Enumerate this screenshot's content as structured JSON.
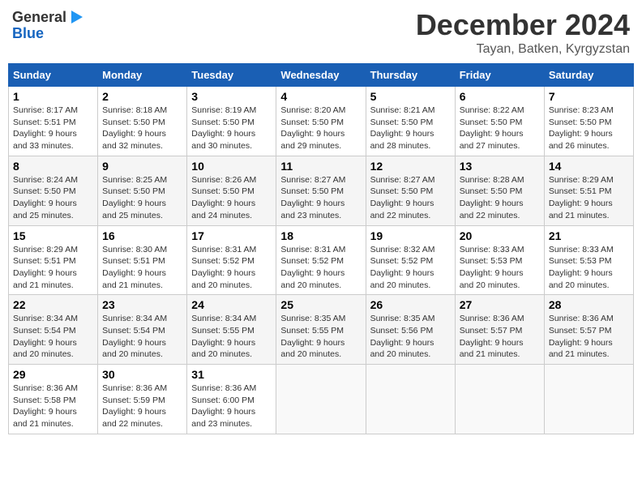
{
  "header": {
    "logo": {
      "general": "General",
      "blue": "Blue"
    },
    "month": "December 2024",
    "location": "Tayan, Batken, Kyrgyzstan"
  },
  "weekdays": [
    "Sunday",
    "Monday",
    "Tuesday",
    "Wednesday",
    "Thursday",
    "Friday",
    "Saturday"
  ],
  "weeks": [
    [
      {
        "day": "1",
        "sunrise": "8:17 AM",
        "sunset": "5:51 PM",
        "daylight": "9 hours and 33 minutes."
      },
      {
        "day": "2",
        "sunrise": "8:18 AM",
        "sunset": "5:50 PM",
        "daylight": "9 hours and 32 minutes."
      },
      {
        "day": "3",
        "sunrise": "8:19 AM",
        "sunset": "5:50 PM",
        "daylight": "9 hours and 30 minutes."
      },
      {
        "day": "4",
        "sunrise": "8:20 AM",
        "sunset": "5:50 PM",
        "daylight": "9 hours and 29 minutes."
      },
      {
        "day": "5",
        "sunrise": "8:21 AM",
        "sunset": "5:50 PM",
        "daylight": "9 hours and 28 minutes."
      },
      {
        "day": "6",
        "sunrise": "8:22 AM",
        "sunset": "5:50 PM",
        "daylight": "9 hours and 27 minutes."
      },
      {
        "day": "7",
        "sunrise": "8:23 AM",
        "sunset": "5:50 PM",
        "daylight": "9 hours and 26 minutes."
      }
    ],
    [
      {
        "day": "8",
        "sunrise": "8:24 AM",
        "sunset": "5:50 PM",
        "daylight": "9 hours and 25 minutes."
      },
      {
        "day": "9",
        "sunrise": "8:25 AM",
        "sunset": "5:50 PM",
        "daylight": "9 hours and 25 minutes."
      },
      {
        "day": "10",
        "sunrise": "8:26 AM",
        "sunset": "5:50 PM",
        "daylight": "9 hours and 24 minutes."
      },
      {
        "day": "11",
        "sunrise": "8:27 AM",
        "sunset": "5:50 PM",
        "daylight": "9 hours and 23 minutes."
      },
      {
        "day": "12",
        "sunrise": "8:27 AM",
        "sunset": "5:50 PM",
        "daylight": "9 hours and 22 minutes."
      },
      {
        "day": "13",
        "sunrise": "8:28 AM",
        "sunset": "5:50 PM",
        "daylight": "9 hours and 22 minutes."
      },
      {
        "day": "14",
        "sunrise": "8:29 AM",
        "sunset": "5:51 PM",
        "daylight": "9 hours and 21 minutes."
      }
    ],
    [
      {
        "day": "15",
        "sunrise": "8:29 AM",
        "sunset": "5:51 PM",
        "daylight": "9 hours and 21 minutes."
      },
      {
        "day": "16",
        "sunrise": "8:30 AM",
        "sunset": "5:51 PM",
        "daylight": "9 hours and 21 minutes."
      },
      {
        "day": "17",
        "sunrise": "8:31 AM",
        "sunset": "5:52 PM",
        "daylight": "9 hours and 20 minutes."
      },
      {
        "day": "18",
        "sunrise": "8:31 AM",
        "sunset": "5:52 PM",
        "daylight": "9 hours and 20 minutes."
      },
      {
        "day": "19",
        "sunrise": "8:32 AM",
        "sunset": "5:52 PM",
        "daylight": "9 hours and 20 minutes."
      },
      {
        "day": "20",
        "sunrise": "8:33 AM",
        "sunset": "5:53 PM",
        "daylight": "9 hours and 20 minutes."
      },
      {
        "day": "21",
        "sunrise": "8:33 AM",
        "sunset": "5:53 PM",
        "daylight": "9 hours and 20 minutes."
      }
    ],
    [
      {
        "day": "22",
        "sunrise": "8:34 AM",
        "sunset": "5:54 PM",
        "daylight": "9 hours and 20 minutes."
      },
      {
        "day": "23",
        "sunrise": "8:34 AM",
        "sunset": "5:54 PM",
        "daylight": "9 hours and 20 minutes."
      },
      {
        "day": "24",
        "sunrise": "8:34 AM",
        "sunset": "5:55 PM",
        "daylight": "9 hours and 20 minutes."
      },
      {
        "day": "25",
        "sunrise": "8:35 AM",
        "sunset": "5:55 PM",
        "daylight": "9 hours and 20 minutes."
      },
      {
        "day": "26",
        "sunrise": "8:35 AM",
        "sunset": "5:56 PM",
        "daylight": "9 hours and 20 minutes."
      },
      {
        "day": "27",
        "sunrise": "8:36 AM",
        "sunset": "5:57 PM",
        "daylight": "9 hours and 21 minutes."
      },
      {
        "day": "28",
        "sunrise": "8:36 AM",
        "sunset": "5:57 PM",
        "daylight": "9 hours and 21 minutes."
      }
    ],
    [
      {
        "day": "29",
        "sunrise": "8:36 AM",
        "sunset": "5:58 PM",
        "daylight": "9 hours and 21 minutes."
      },
      {
        "day": "30",
        "sunrise": "8:36 AM",
        "sunset": "5:59 PM",
        "daylight": "9 hours and 22 minutes."
      },
      {
        "day": "31",
        "sunrise": "8:36 AM",
        "sunset": "6:00 PM",
        "daylight": "9 hours and 23 minutes."
      },
      null,
      null,
      null,
      null
    ]
  ]
}
